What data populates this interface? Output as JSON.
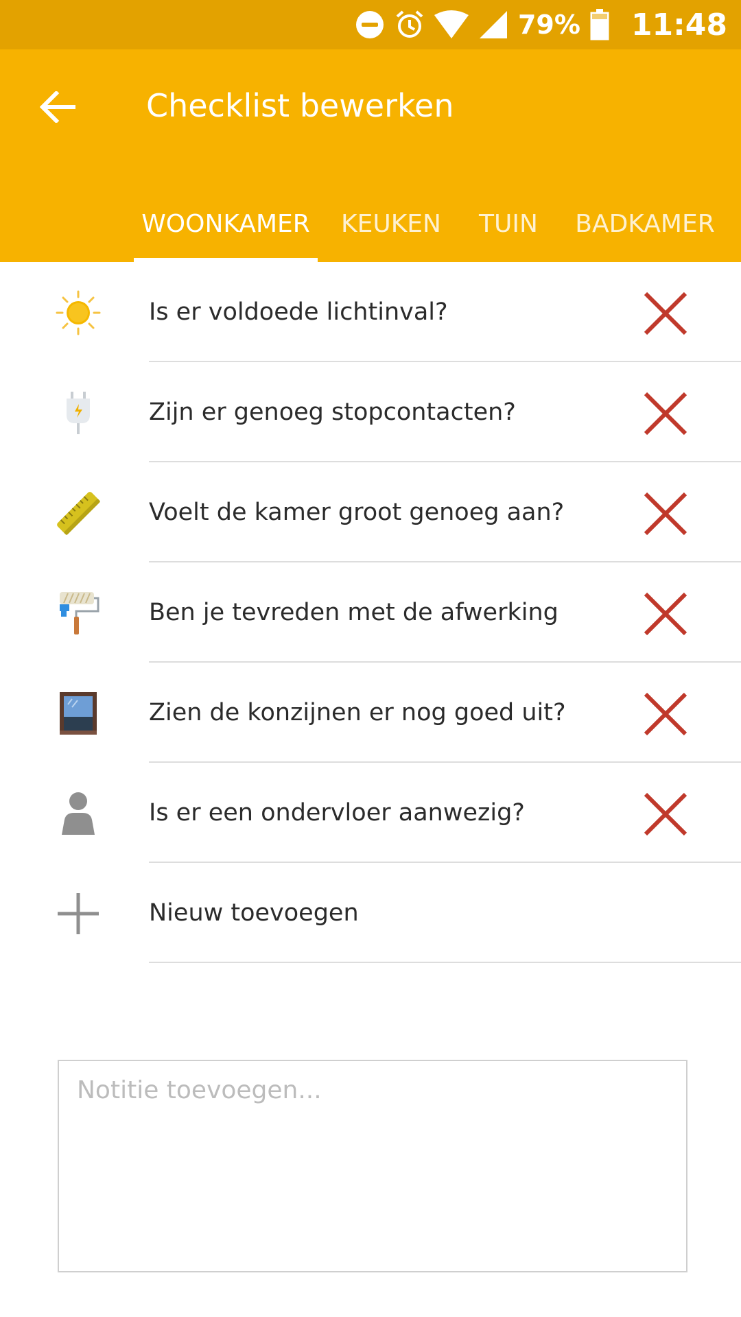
{
  "status_bar": {
    "battery_percent": "79%",
    "time": "11:48",
    "icons": [
      "do-not-disturb-icon",
      "alarm-icon",
      "wifi-icon",
      "signal-icon",
      "battery-icon"
    ]
  },
  "app_bar": {
    "title": "Checklist bewerken",
    "back_icon": "arrow-left-icon"
  },
  "tabs": [
    {
      "label": "WOONKAMER",
      "active": true
    },
    {
      "label": "KEUKEN",
      "active": false
    },
    {
      "label": "TUIN",
      "active": false
    },
    {
      "label": "BADKAMER",
      "active": false
    }
  ],
  "checklist": {
    "items": [
      {
        "label": "Is er voldoede lichtinval?",
        "icon": "sun-icon"
      },
      {
        "label": "Zijn er genoeg stopcontacten?",
        "icon": "plug-icon"
      },
      {
        "label": "Voelt de kamer groot genoeg aan?",
        "icon": "ruler-icon"
      },
      {
        "label": "Ben je tevreden met de afwerking",
        "icon": "paint-roller-icon"
      },
      {
        "label": "Zien de konzijnen er nog goed uit?",
        "icon": "window-frame-icon"
      },
      {
        "label": "Is er een ondervloer aanwezig?",
        "icon": "person-icon"
      }
    ],
    "remove_icon": "close-x-icon",
    "add_label": "Nieuw toevoegen",
    "add_icon": "plus-icon"
  },
  "note": {
    "placeholder": "Notitie toevoegen...",
    "value": ""
  },
  "colors": {
    "status_bar": "#e3a200",
    "app_bar": "#f7b200",
    "remove_red": "#c0392b",
    "divider": "#dddddd"
  }
}
